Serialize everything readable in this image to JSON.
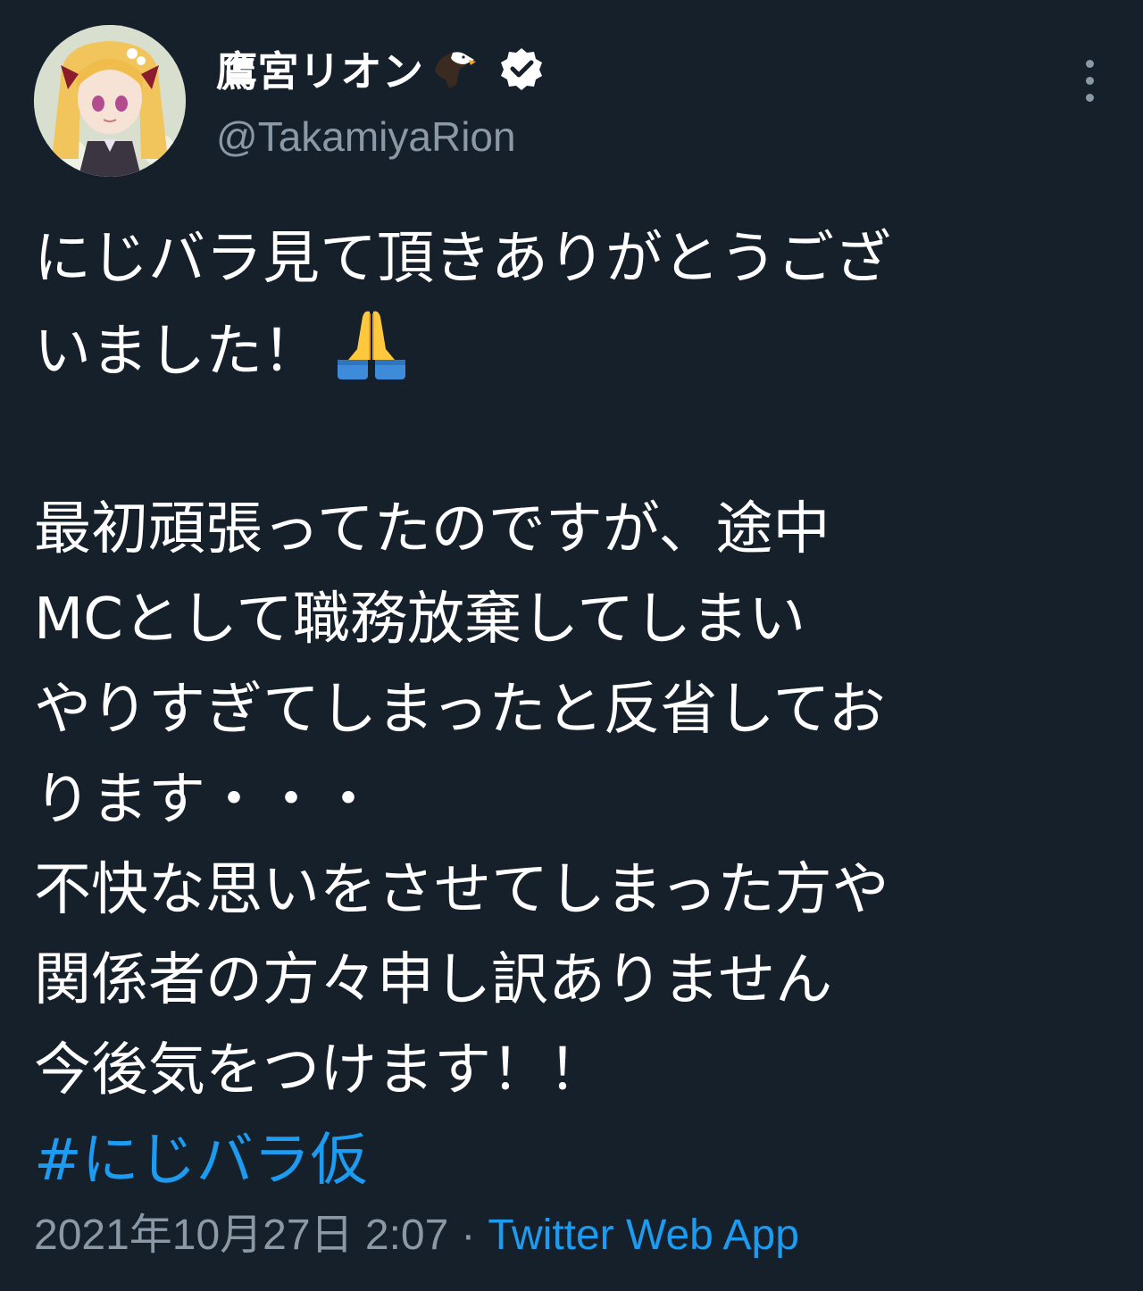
{
  "user": {
    "display_name": "鷹宮リオン",
    "handle": "@TakamiyaRion",
    "name_emoji_icon": "eagle-icon",
    "verified_icon": "verified-badge-icon",
    "avatar_icon": "avatar-anime-girl"
  },
  "menu": {
    "more_icon": "more-vertical-icon"
  },
  "tweet": {
    "lines": [
      "にじバラ見て頂きありがとうござ",
      "いました！",
      "",
      "最初頑張ってたのですが、途中",
      "MCとして職務放棄してしまい",
      "やりすぎてしまったと反省してお",
      "ります・・・",
      "不快な思いをさせてしまった方や",
      "関係者の方々申し訳ありません",
      "今後気をつけます！！"
    ],
    "emoji_after_line_2": "folded-hands-icon",
    "hashtag": "#にじバラ仮"
  },
  "meta": {
    "timestamp": "2021年10月27日 2:07",
    "separator": "·",
    "source": "Twitter Web App"
  },
  "colors": {
    "background": "#15202b",
    "text": "#ffffff",
    "secondary": "#8b98a5",
    "accent": "#1d9bf0"
  }
}
